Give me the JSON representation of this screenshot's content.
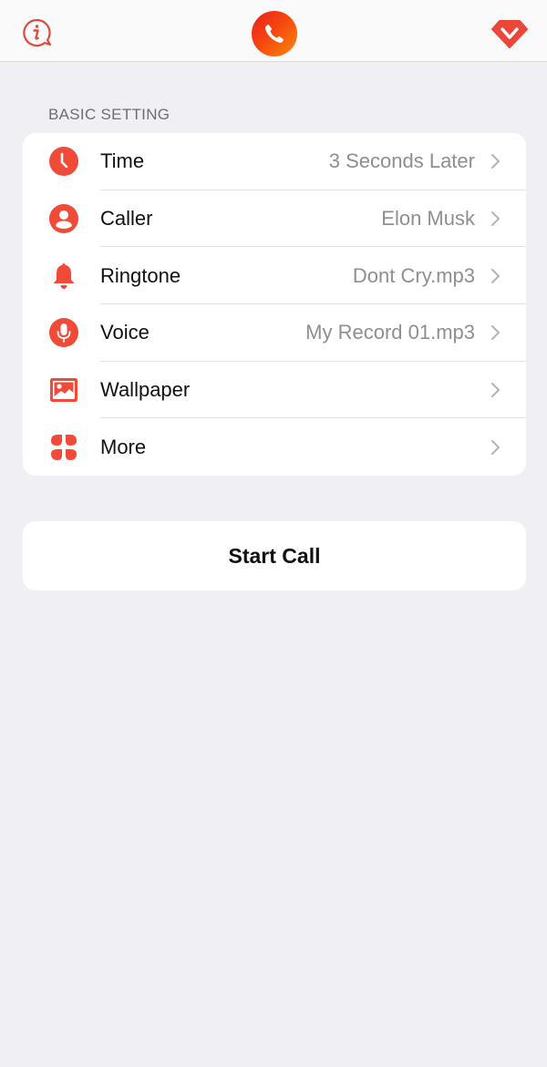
{
  "topbar": {
    "left_icon": "info-bubble-icon",
    "center_icon": "phone-logo-icon",
    "right_icon": "premium-gem-icon"
  },
  "colors": {
    "accent": "#f24a38",
    "logo_gradient_start": "#ea1f1f",
    "logo_gradient_end": "#fb8a0a",
    "background": "#f0eff4",
    "secondary_text": "#8e8e93"
  },
  "section": {
    "title": "BASIC SETTING",
    "items": [
      {
        "icon": "clock-icon",
        "label": "Time",
        "value": "3 Seconds Later"
      },
      {
        "icon": "person-icon",
        "label": "Caller",
        "value": "Elon Musk"
      },
      {
        "icon": "bell-icon",
        "label": "Ringtone",
        "value": "Dont Cry.mp3"
      },
      {
        "icon": "microphone-icon",
        "label": "Voice",
        "value": "My Record 01.mp3"
      },
      {
        "icon": "image-icon",
        "label": "Wallpaper",
        "value": ""
      },
      {
        "icon": "grid-icon",
        "label": "More",
        "value": ""
      }
    ]
  },
  "actions": {
    "start_call_label": "Start Call"
  }
}
